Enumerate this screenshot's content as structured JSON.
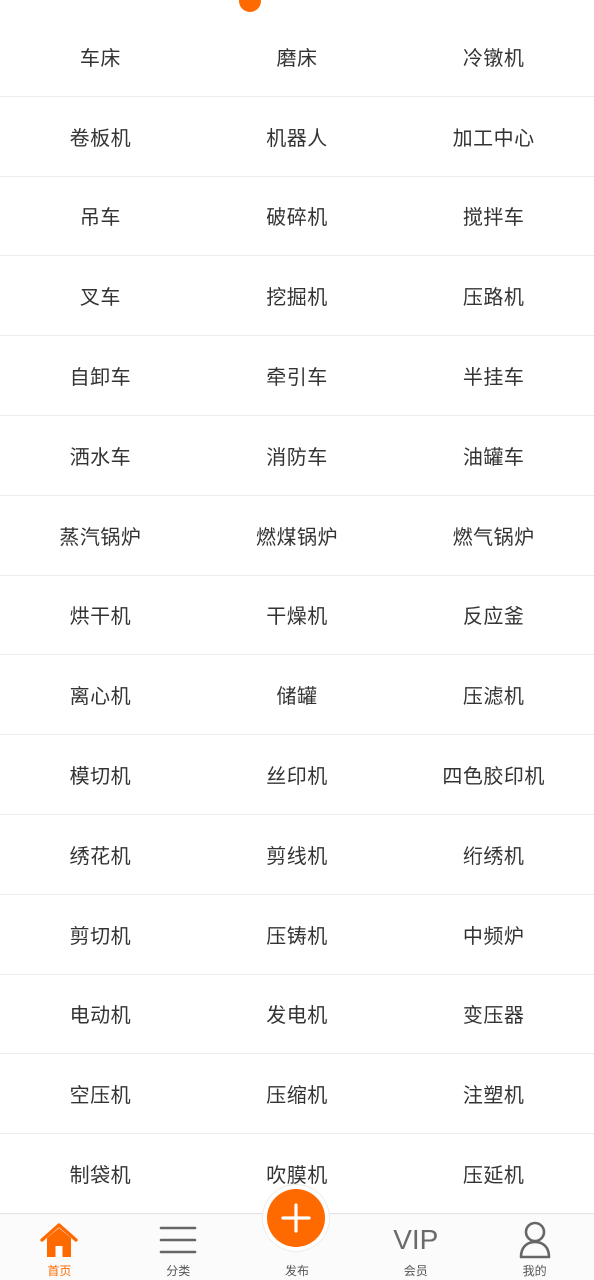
{
  "header_peek": {
    "text": "···"
  },
  "categories": [
    [
      "车床",
      "磨床",
      "冷镦机"
    ],
    [
      "卷板机",
      "机器人",
      "加工中心"
    ],
    [
      "吊车",
      "破碎机",
      "搅拌车"
    ],
    [
      "叉车",
      "挖掘机",
      "压路机"
    ],
    [
      "自卸车",
      "牵引车",
      "半挂车"
    ],
    [
      "洒水车",
      "消防车",
      "油罐车"
    ],
    [
      "蒸汽锅炉",
      "燃煤锅炉",
      "燃气锅炉"
    ],
    [
      "烘干机",
      "干燥机",
      "反应釜"
    ],
    [
      "离心机",
      "储罐",
      "压滤机"
    ],
    [
      "模切机",
      "丝印机",
      "四色胶印机"
    ],
    [
      "绣花机",
      "剪线机",
      "绗绣机"
    ],
    [
      "剪切机",
      "压铸机",
      "中频炉"
    ],
    [
      "电动机",
      "发电机",
      "变压器"
    ],
    [
      "空压机",
      "压缩机",
      "注塑机"
    ],
    [
      "制袋机",
      "吹膜机",
      "压延机"
    ]
  ],
  "tabbar": {
    "home_label": "首页",
    "category_label": "分类",
    "publish_label": "发布",
    "vip_icon_text": "VIP",
    "vip_label": "会员",
    "mine_label": "我的"
  },
  "icons": {
    "home": "home-icon",
    "category": "menu-icon",
    "publish": "plus-icon",
    "vip": "vip-icon",
    "mine": "user-icon"
  },
  "colors": {
    "accent": "#ff6a00",
    "text": "#333333",
    "divider": "#ececec",
    "tab_inactive": "#555555"
  }
}
